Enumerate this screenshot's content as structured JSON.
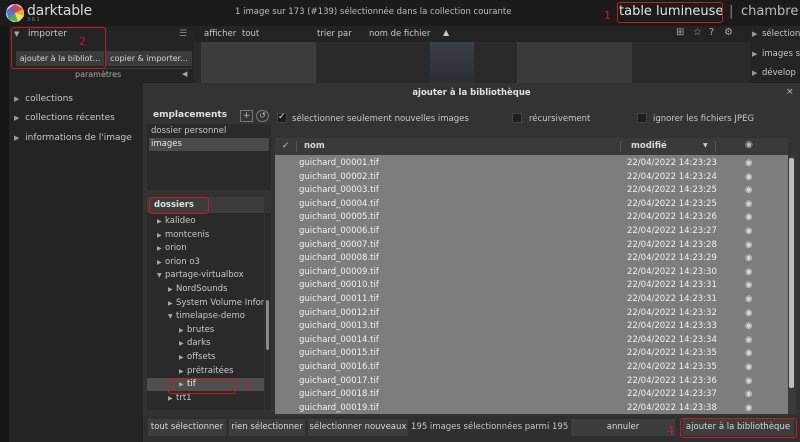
{
  "app": {
    "name": "darktable",
    "version": "3.8.1"
  },
  "header": {
    "collection_info": "1 image sur 173 (#139) sélectionnée dans la collection courante",
    "views": {
      "lighttable": "table lumineuse",
      "separator": "|",
      "darkroom": "chambre"
    }
  },
  "filterbar": {
    "show_label": "afficher",
    "show_value": "tout",
    "sort_label": "trier par",
    "sort_value": "nom de fichier"
  },
  "left_panel": {
    "import_module": "importer",
    "add_to_library_button": "ajouter à la bibliot...",
    "copy_import_button": "copier & importer...",
    "parameters": "paramètres",
    "modules": [
      "collections",
      "collections récentes",
      "informations de l'image"
    ]
  },
  "right_panel": {
    "modules": [
      "sélection",
      "images s",
      "dévelop"
    ]
  },
  "dialog": {
    "title": "ajouter à la bibliothèque",
    "close": "×",
    "places_title": "emplacements",
    "places": [
      "dossier personnel",
      "images"
    ],
    "folders_title": "dossiers",
    "tree": [
      {
        "label": "kalideo",
        "depth": 0,
        "expanded": false
      },
      {
        "label": "montcenis",
        "depth": 0,
        "expanded": false
      },
      {
        "label": "orion",
        "depth": 0,
        "expanded": false
      },
      {
        "label": "orion o3",
        "depth": 0,
        "expanded": false
      },
      {
        "label": "partage-virtualbox",
        "depth": 0,
        "expanded": true
      },
      {
        "label": "NordSounds",
        "depth": 1,
        "expanded": false
      },
      {
        "label": "System Volume Infor",
        "depth": 1,
        "expanded": false
      },
      {
        "label": "timelapse-demo",
        "depth": 1,
        "expanded": true
      },
      {
        "label": "brutes",
        "depth": 2,
        "expanded": false
      },
      {
        "label": "darks",
        "depth": 2,
        "expanded": false
      },
      {
        "label": "offsets",
        "depth": 2,
        "expanded": false
      },
      {
        "label": "prétraitées",
        "depth": 2,
        "expanded": false
      },
      {
        "label": "tif",
        "depth": 2,
        "expanded": false,
        "selected": true
      },
      {
        "label": "trt1",
        "depth": 1,
        "expanded": false
      }
    ],
    "options": {
      "only_new": "sélectionner seulement nouvelles images",
      "recursive": "récursivement",
      "ignore_jpeg": "ignorer les fichiers JPEG"
    },
    "columns": {
      "check": "✓",
      "name": "nom",
      "modified": "modifié",
      "thumb_icon": "eye-icon"
    },
    "files": [
      {
        "name": "guichard_00001.tif",
        "date": "22/04/2022 14:23:23"
      },
      {
        "name": "guichard_00002.tif",
        "date": "22/04/2022 14:23:24"
      },
      {
        "name": "guichard_00003.tif",
        "date": "22/04/2022 14:23:25"
      },
      {
        "name": "guichard_00004.tif",
        "date": "22/04/2022 14:23:25"
      },
      {
        "name": "guichard_00005.tif",
        "date": "22/04/2022 14:23:26"
      },
      {
        "name": "guichard_00006.tif",
        "date": "22/04/2022 14:23:27"
      },
      {
        "name": "guichard_00007.tif",
        "date": "22/04/2022 14:23:28"
      },
      {
        "name": "guichard_00008.tif",
        "date": "22/04/2022 14:23:29"
      },
      {
        "name": "guichard_00009.tif",
        "date": "22/04/2022 14:23:30"
      },
      {
        "name": "guichard_00010.tif",
        "date": "22/04/2022 14:23:31"
      },
      {
        "name": "guichard_00011.tif",
        "date": "22/04/2022 14:23:31"
      },
      {
        "name": "guichard_00012.tif",
        "date": "22/04/2022 14:23:32"
      },
      {
        "name": "guichard_00013.tif",
        "date": "22/04/2022 14:23:33"
      },
      {
        "name": "guichard_00014.tif",
        "date": "22/04/2022 14:23:34"
      },
      {
        "name": "guichard_00015.tif",
        "date": "22/04/2022 14:23:35"
      },
      {
        "name": "guichard_00016.tif",
        "date": "22/04/2022 14:23:35"
      },
      {
        "name": "guichard_00017.tif",
        "date": "22/04/2022 14:23:36"
      },
      {
        "name": "guichard_00018.tif",
        "date": "22/04/2022 14:23:37"
      },
      {
        "name": "guichard_00019.tif",
        "date": "22/04/2022 14:23:38"
      }
    ],
    "buttons": {
      "select_all": "tout sélectionner",
      "select_none": "rien sélectionner",
      "select_new": "sélectionner nouveaux",
      "count": "195 images sélectionnées parmi 195",
      "cancel": "annuler",
      "add": "ajouter à la bibliothèque"
    }
  },
  "annotations": [
    "1",
    "2",
    "3",
    "4"
  ],
  "colors": {
    "annotation": "#d01818",
    "selected_rows": "#7d7d7d"
  }
}
